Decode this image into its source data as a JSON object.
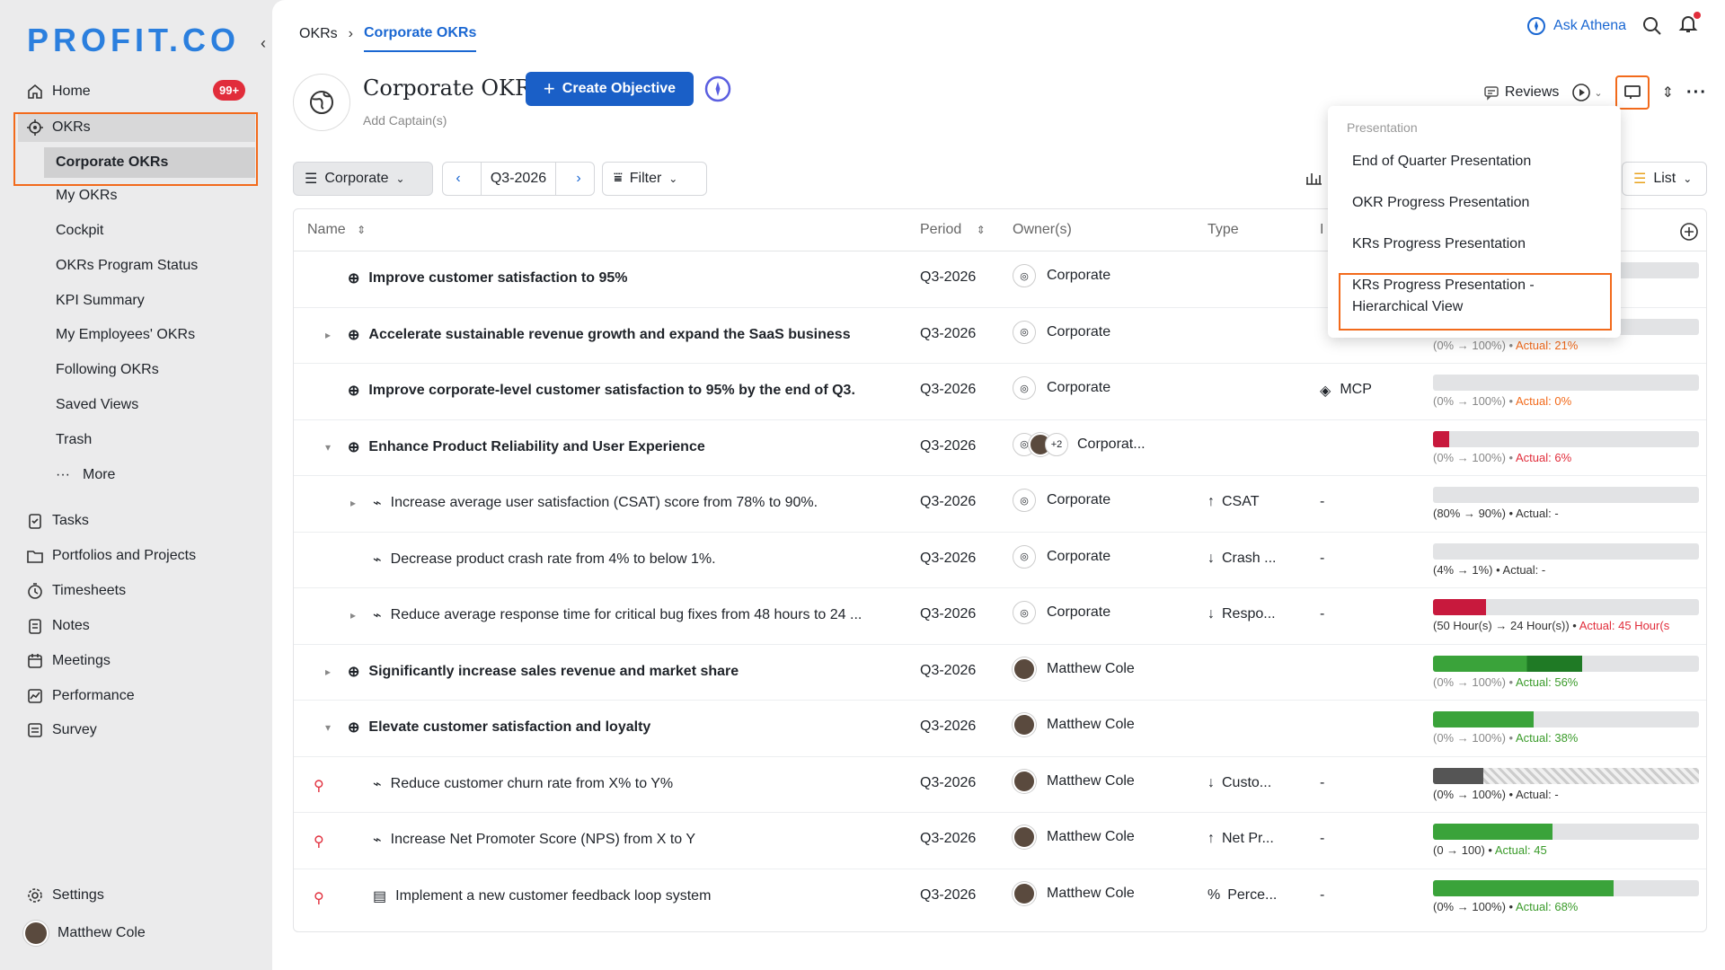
{
  "brand": {
    "logo": "PROFIT.CO"
  },
  "sidebar": {
    "home": "Home",
    "home_badge": "99+",
    "okrs": "OKRs",
    "sub": [
      "Corporate OKRs",
      "My OKRs",
      "Cockpit",
      "OKRs Program Status",
      "KPI Summary",
      "My Employees' OKRs",
      "Following OKRs",
      "Saved Views",
      "Trash",
      "More"
    ],
    "apps": [
      "Tasks",
      "Portfolios and Projects",
      "Timesheets",
      "Notes",
      "Meetings",
      "Performance",
      "Survey"
    ],
    "settings": "Settings",
    "user": "Matthew Cole"
  },
  "breadcrumb": {
    "root": "OKRs",
    "current": "Corporate OKRs"
  },
  "topbar": {
    "ask": "Ask Athena"
  },
  "header": {
    "title": "Corporate OKRs",
    "subtitle": "Add Captain(s)",
    "create": "Create Objective",
    "reviews": "Reviews"
  },
  "toolbar": {
    "scope": "Corporate",
    "period": "Q3-2026",
    "filter": "Filter",
    "view": "List"
  },
  "columns": {
    "name": "Name",
    "period": "Period",
    "owners": "Owner(s)",
    "type": "Type",
    "i": "I"
  },
  "rows": [
    {
      "name": "Improve customer satisfaction to 95%",
      "period": "Q3-2026",
      "owner": "Corporate",
      "type": "",
      "i": "",
      "range": "",
      "actual": ""
    },
    {
      "name": "Accelerate sustainable revenue growth and expand the SaaS business",
      "period": "Q3-2026",
      "owner": "Corporate",
      "type": "",
      "i": "",
      "range": "(0% → 100%) • ",
      "actual": "Actual: 21%"
    },
    {
      "name": "Improve corporate-level customer satisfaction to 95% by the end of Q3.",
      "period": "Q3-2026",
      "owner": "Corporate",
      "type": "",
      "i": "MCP",
      "range": "(0% → 100%) • ",
      "actual": "Actual: 0%"
    },
    {
      "name": "Enhance Product Reliability and User Experience",
      "period": "Q3-2026",
      "owner": "Corporat...",
      "extra": "+2",
      "type": "",
      "i": "",
      "range": "(0% → 100%) • ",
      "actual": "Actual: 6%"
    },
    {
      "name": "Increase average user satisfaction (CSAT) score from 78% to 90%.",
      "period": "Q3-2026",
      "owner": "Corporate",
      "type": "CSAT",
      "i": "-",
      "range": "(80%  →  90%) • ",
      "actual": "Actual: -"
    },
    {
      "name": "Decrease product crash rate from 4% to below 1%.",
      "period": "Q3-2026",
      "owner": "Corporate",
      "type": "Crash ...",
      "i": "-",
      "range": "(4%  →  1%) • ",
      "actual": "Actual: -"
    },
    {
      "name": "Reduce average response time for critical bug fixes from 48 hours to 24 ...",
      "period": "Q3-2026",
      "owner": "Corporate",
      "type": "Respo...",
      "i": "-",
      "range": "(50 Hour(s)  →  24 Hour(s)) • ",
      "actual": "Actual: 45 Hour(s"
    },
    {
      "name": "Significantly increase sales revenue and market share",
      "period": "Q3-2026",
      "owner": "Matthew Cole",
      "type": "",
      "i": "",
      "range": "(0% → 100%) • ",
      "actual": "Actual: 56%"
    },
    {
      "name": "Elevate customer satisfaction and loyalty",
      "period": "Q3-2026",
      "owner": "Matthew Cole",
      "type": "",
      "i": "",
      "range": "(0% → 100%) • ",
      "actual": "Actual: 38%"
    },
    {
      "name": "Reduce customer churn rate from X% to Y%",
      "period": "Q3-2026",
      "owner": "Matthew Cole",
      "type": "Custo...",
      "i": "-",
      "range": "(0%  →  100%) • ",
      "actual": "Actual: -"
    },
    {
      "name": "Increase Net Promoter Score (NPS) from X to Y",
      "period": "Q3-2026",
      "owner": "Matthew Cole",
      "type": "Net Pr...",
      "i": "-",
      "range": "(0  →  100) • ",
      "actual": "Actual: 45"
    },
    {
      "name": "Implement a new customer feedback loop system",
      "period": "Q3-2026",
      "owner": "Matthew Cole",
      "type": "Perce...",
      "i": "-",
      "range": "(0%  →  100%) • ",
      "actual": "Actual: 68%"
    }
  ],
  "dropdown": {
    "header": "Presentation",
    "options": [
      "End of Quarter Presentation",
      "OKR Progress Presentation",
      "KRs Progress Presentation",
      "KRs Progress Presentation -",
      "Hierarchical View"
    ]
  }
}
